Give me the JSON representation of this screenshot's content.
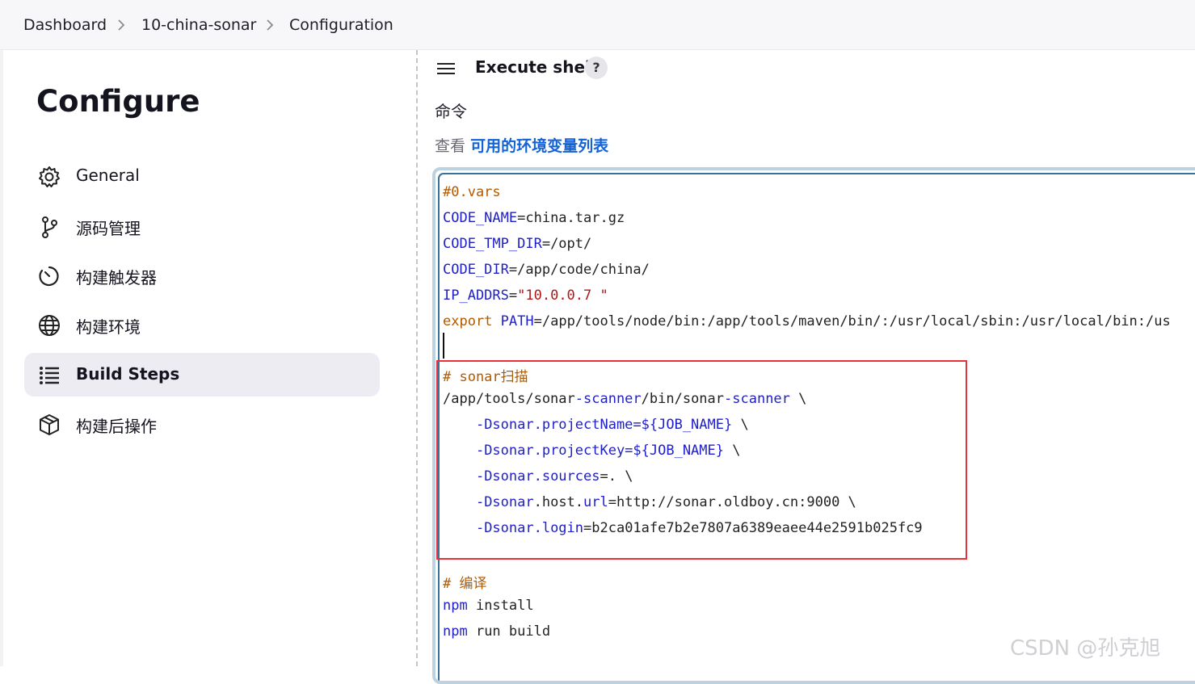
{
  "breadcrumb": {
    "items": [
      "Dashboard",
      "10-china-sonar",
      "Configuration"
    ]
  },
  "page": {
    "title": "Configure"
  },
  "sidebar": {
    "items": [
      {
        "label": "General",
        "icon": "gear-icon"
      },
      {
        "label": "源码管理",
        "icon": "git-branch-icon"
      },
      {
        "label": "构建触发器",
        "icon": "clock-icon"
      },
      {
        "label": "构建环境",
        "icon": "globe-icon"
      },
      {
        "label": "Build Steps",
        "icon": "list-icon",
        "active": true
      },
      {
        "label": "构建后操作",
        "icon": "package-icon"
      }
    ]
  },
  "step": {
    "title": "Execute shell",
    "help": "?",
    "command_label": "命令",
    "env_prefix": "查看",
    "env_link": "可用的环境变量列表"
  },
  "code": {
    "l1": "#0.vars",
    "l2_var": "CODE_NAME",
    "l2_val": "=china.tar.gz",
    "l3_var": "CODE_TMP_DIR",
    "l3_val": "=/opt/",
    "l4_var": "CODE_DIR",
    "l4_val": "=/app/code/china/",
    "l5_var": "IP_ADDRS",
    "l5_eq": "=",
    "l5_str": "\"10.0.0.7 \"",
    "l6_kw": "export",
    "l6_var": "PATH",
    "l6_val": "=/app/tools/node/bin:/app/tools/maven/bin/:/usr/local/sbin:/usr/local/bin:/us",
    "l8": "# sonar扫描",
    "l9_a": "/app/tools/sonar",
    "l9_b": "-scanner",
    "l9_c": "/bin/sonar",
    "l9_d": "-scanner",
    "l9_e": " \\",
    "l10_a": "    ",
    "l10_b": "-Dsonar.projectName=${JOB_NAME}",
    "l10_c": " \\",
    "l11_b": "-Dsonar.projectKey=${JOB_NAME}",
    "l11_c": " \\",
    "l12_b": "-Dsonar.sources",
    "l12_c": "=. \\",
    "l13_b": "-Dsonar",
    "l13_c": ".host.",
    "l13_d": "url",
    "l13_e": "=http://sonar.oldboy.cn:9000 \\",
    "l14_b": "-Dsonar.login",
    "l14_c": "=b2ca01afe7b2e7807a6389eaee44e2591b025fc9",
    "l16": "# 编译",
    "l17_kw": "npm",
    "l17_val": " install",
    "l18_kw": "npm",
    "l18_val": " run build"
  },
  "watermark": "CSDN @孙克旭",
  "colors": {
    "accent": "#1262d8",
    "highlight": "#e8313a",
    "active_bg": "#ececf2"
  }
}
